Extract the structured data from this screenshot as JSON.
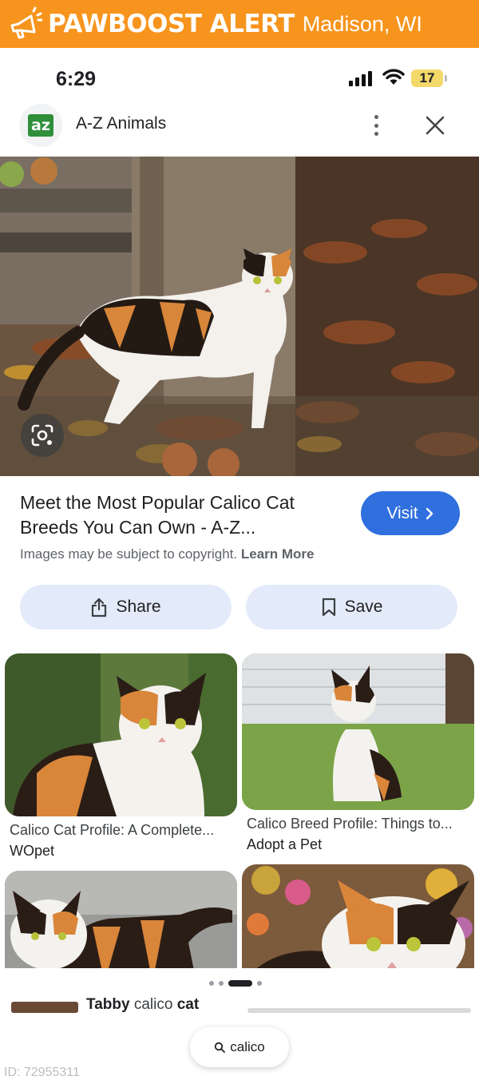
{
  "banner": {
    "brand": "PAWBOOST ALERT",
    "location": "Madison, WI",
    "color": "#f7941d"
  },
  "status_bar": {
    "time": "6:29",
    "battery": "17"
  },
  "app_header": {
    "title": "A-Z Animals",
    "logo_text": "az"
  },
  "result": {
    "title": "Meet the Most Popular Calico Cat Breeds You Can Own - A-Z...",
    "visit_label": "Visit",
    "copyright_text": "Images may be subject to copyright.",
    "learn_more": "Learn More",
    "share_label": "Share",
    "save_label": "Save",
    "accent_color": "#2f6fde"
  },
  "related": [
    {
      "caption": "Calico Cat Profile: A Complete...",
      "source": "WOpet"
    },
    {
      "caption": "Calico Breed Profile: Things to...",
      "source": "Adopt a Pet"
    }
  ],
  "partial_caption": {
    "prefix": "Tabby",
    "middle": " calico ",
    "suffix": "cat"
  },
  "search": {
    "query": "calico"
  },
  "footer_id": "ID: 72955311",
  "icons": [
    "megaphone-icon",
    "signal-icon",
    "wifi-icon",
    "battery-icon",
    "more-vert-icon",
    "close-icon",
    "lens-icon",
    "chevron-right-icon",
    "share-icon",
    "bookmark-icon",
    "search-icon"
  ]
}
